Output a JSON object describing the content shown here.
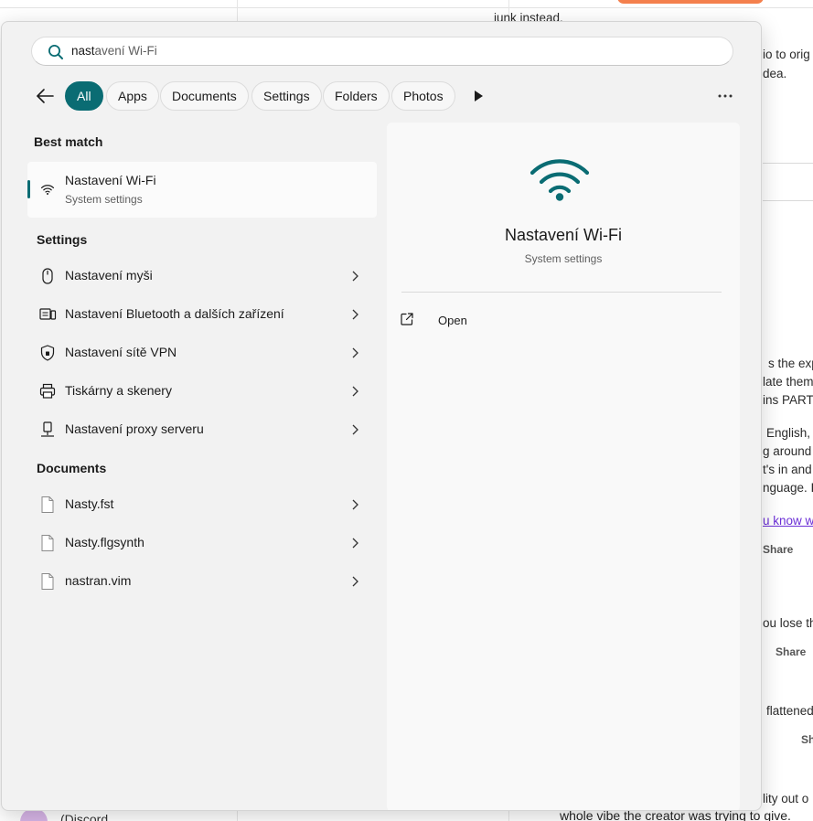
{
  "background": {
    "lines": [
      "junk instead.",
      "io to orig",
      "dea.",
      "s the expe",
      "late them",
      "ins PARTS",
      "English,",
      "g around",
      "t's in and",
      "nguage. It",
      "u know w",
      "Share",
      "ou lose th",
      "Share",
      "flattened",
      "Sh",
      "lity out o",
      "whole vibe the creator was trying to give.",
      "(Discord"
    ]
  },
  "search": {
    "query_typed": "nast",
    "query_rest": "avení Wi-Fi"
  },
  "filters": {
    "chips": [
      "All",
      "Apps",
      "Documents",
      "Settings",
      "Folders",
      "Photos"
    ]
  },
  "sections": {
    "best_match": "Best match",
    "settings": "Settings",
    "documents": "Documents"
  },
  "best_match": {
    "name": "Nastavení Wi-Fi",
    "subtitle": "System settings"
  },
  "settings_items": [
    {
      "label": "Nastavení myši",
      "icon": "mouse-icon"
    },
    {
      "label": "Nastavení Bluetooth a dalších zařízení",
      "icon": "keyboard-devices-icon"
    },
    {
      "label": "Nastavení sítě VPN",
      "icon": "shield-icon"
    },
    {
      "label": "Tiskárny a skenery",
      "icon": "printer-icon"
    },
    {
      "label": "Nastavení proxy serveru",
      "icon": "proxy-icon"
    }
  ],
  "documents": [
    {
      "label": "Nasty.fst"
    },
    {
      "label": "Nasty.flgsynth"
    },
    {
      "label": "nastran.vim"
    }
  ],
  "detail": {
    "title": "Nastavení Wi-Fi",
    "subtitle": "System settings",
    "open_label": "Open"
  },
  "colors": {
    "accent": "#0a6c73"
  }
}
